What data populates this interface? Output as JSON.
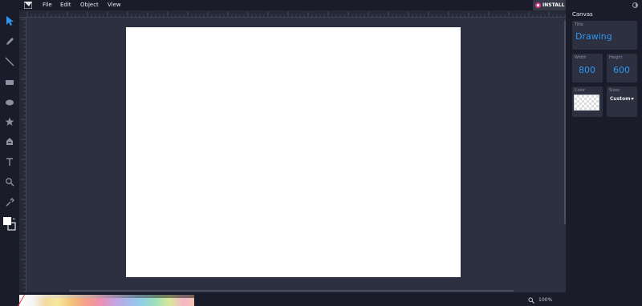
{
  "menu": {
    "items": [
      "File",
      "Edit",
      "Object",
      "View"
    ],
    "install_label": "INSTALL"
  },
  "tools": [
    "select-tool",
    "pencil-tool",
    "line-tool",
    "rectangle-tool",
    "ellipse-tool",
    "star-tool",
    "fill-tool",
    "text-tool",
    "zoom-tool",
    "eyedropper-tool"
  ],
  "panel": {
    "title": "Canvas",
    "title_field": {
      "label": "Title",
      "value": "Drawing"
    },
    "width_field": {
      "label": "Width",
      "value": "800"
    },
    "height_field": {
      "label": "Height",
      "value": "600"
    },
    "color_field": {
      "label": "Color"
    },
    "sizes_field": {
      "label": "Sizes",
      "value": "Custom"
    }
  },
  "status": {
    "zoom": "100%"
  },
  "colors": {
    "accent": "#2f97f0",
    "background": "#1a1d29",
    "workspace": "#2c3040",
    "install_badge": "#d73a8e"
  }
}
